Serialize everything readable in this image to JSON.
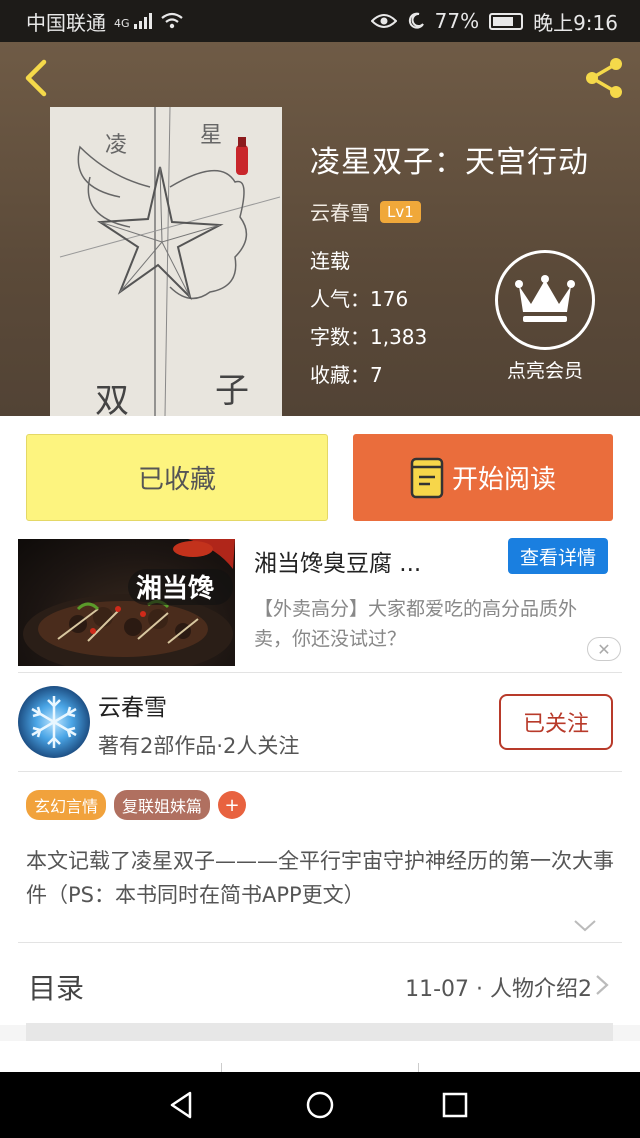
{
  "status_bar": {
    "carrier": "中国联通",
    "network": "4G",
    "battery": "77%",
    "time": "晚上9:16"
  },
  "book": {
    "title": "凌星双子：天宫行动",
    "author": "云春雪",
    "level": "Lv1",
    "status": "连载",
    "popularity": "人气：176",
    "word_count": "字数：1,383",
    "favorites": "收藏：7",
    "vip_label": "点亮会员",
    "cover_text": {
      "top_left": "凌",
      "top_right": "星",
      "bottom_left": "双",
      "bottom_right": "子"
    }
  },
  "actions": {
    "favorited_label": "已收藏",
    "read_label": "开始阅读"
  },
  "ad": {
    "title": "湘当馋臭豆腐 ...",
    "details_button": "查看详情",
    "description": "【外卖高分】大家都爱吃的高分品质外卖，你还没试过？",
    "image_text": "湘当馋",
    "close_icon": "close-icon"
  },
  "author_box": {
    "name": "云春雪",
    "summary": "著有2部作品·2人关注",
    "follow_label": "已关注"
  },
  "tags": [
    "玄幻言情",
    "复联姐妹篇"
  ],
  "tag_add": "+",
  "intro": "本文记载了凌星双子———全平行宇宙守护神经历的第一次大事件（PS：本书同时在简书APP更文）",
  "toc": {
    "label": "目录",
    "latest": "11-07 · 人物介绍2"
  },
  "colors": {
    "header_bg": "#5f4d3b",
    "favorite_btn": "#fdf47f",
    "read_btn": "#ea6d3c",
    "follow_accent": "#b83a2a",
    "ad_btn": "#1a7fe0",
    "level_badge": "#f0a83a"
  }
}
